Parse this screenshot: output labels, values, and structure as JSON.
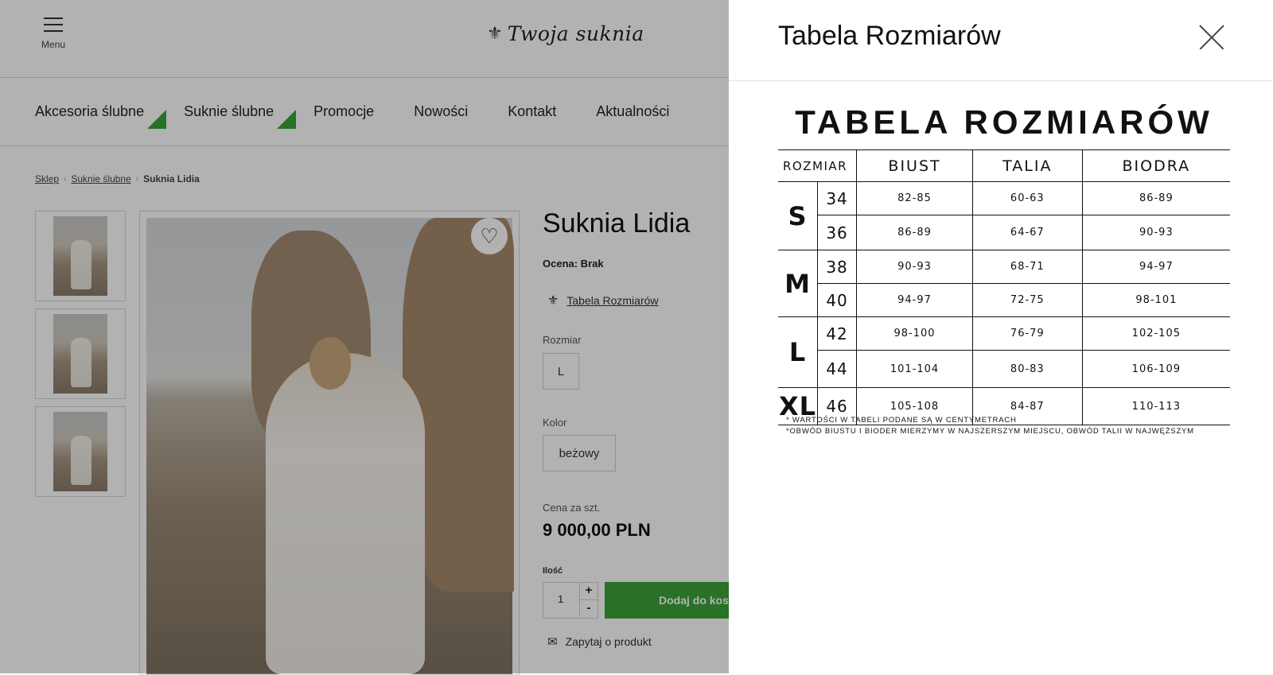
{
  "header": {
    "menu_label": "Menu",
    "logo_text": "Twoja suknia"
  },
  "nav": [
    "Akcesoria ślubne",
    "Suknie ślubne",
    "Promocje",
    "Nowości",
    "Kontakt",
    "Aktualności"
  ],
  "breadcrumbs": [
    "Sklep",
    "Suknie ślubne",
    "Suknia Lidia"
  ],
  "product": {
    "title": "Suknia Lidia",
    "rating": "Ocena: Brak",
    "size_table_link": "Tabela Rozmiarów",
    "size_label": "Rozmiar",
    "size_value": "L",
    "color_label": "Kolor",
    "color_value": "beżowy",
    "price_label": "Cena za szt.",
    "price": "9 000,00 PLN",
    "qty_label": "Ilość",
    "qty_value": "1",
    "qty_plus": "+",
    "qty_minus": "-",
    "add_button": "Dodaj do koszyka",
    "ask_link": "Zapytaj o produkt"
  },
  "drawer": {
    "title": "Tabela Rozmiarów",
    "chart_title": "TABELA ROZMIARÓW",
    "headers": [
      "ROZMIAR",
      "BIUST",
      "TALIA",
      "BIODRA"
    ],
    "groups": [
      {
        "label": "S",
        "rows": [
          {
            "size": "34",
            "biust": "82-85",
            "talia": "60-63",
            "biodra": "86-89"
          },
          {
            "size": "36",
            "biust": "86-89",
            "talia": "64-67",
            "biodra": "90-93"
          }
        ]
      },
      {
        "label": "M",
        "rows": [
          {
            "size": "38",
            "biust": "90-93",
            "talia": "68-71",
            "biodra": "94-97"
          },
          {
            "size": "40",
            "biust": "94-97",
            "talia": "72-75",
            "biodra": "98-101"
          }
        ]
      },
      {
        "label": "L",
        "rows": [
          {
            "size": "42",
            "biust": "98-100",
            "talia": "76-79",
            "biodra": "102-105"
          },
          {
            "size": "44",
            "biust": "101-104",
            "talia": "80-83",
            "biodra": "106-109"
          }
        ]
      },
      {
        "label": "XL",
        "rows": [
          {
            "size": "46",
            "biust": "105-108",
            "talia": "84-87",
            "biodra": "110-113"
          }
        ]
      }
    ],
    "notes": [
      "* WARTOŚCI W TABELI PODANE SĄ W CENTYMETRACH",
      "*OBWÓD BIUSTU I BIODER MIERZYMY W NAJSZERSZYM MIEJSCU, OBWÓD TALII W NAJWĘŻSZYM"
    ]
  },
  "colors": {
    "accent_green": "#3aa239",
    "overlay": "rgba(0,0,0,0.30)"
  },
  "icons": {
    "menu": "hamburger-icon",
    "favorite": "heart-icon",
    "close": "close-icon",
    "mail": "mail-icon",
    "logo": "fleur-de-lis-icon"
  }
}
